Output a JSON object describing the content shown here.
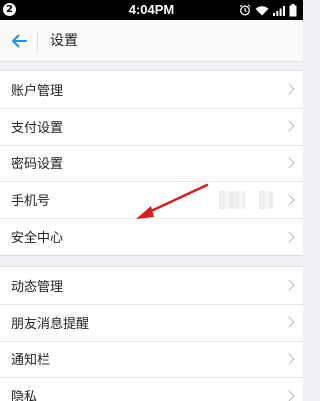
{
  "status_bar": {
    "notification_count": "2",
    "time": "4:04PM",
    "icons": [
      "alarm-icon",
      "wifi-icon",
      "signal-icon",
      "battery-icon"
    ]
  },
  "header": {
    "back_icon": "back-arrow-icon",
    "title": "设置"
  },
  "groups": [
    {
      "items": [
        {
          "label": "账户管理"
        },
        {
          "label": "支付设置"
        },
        {
          "label": "密码设置"
        },
        {
          "label": "手机号"
        },
        {
          "label": "安全中心"
        }
      ]
    },
    {
      "items": [
        {
          "label": "动态管理"
        },
        {
          "label": "朋友消息提醒"
        },
        {
          "label": "通知栏"
        },
        {
          "label": "隐私"
        }
      ]
    }
  ],
  "colors": {
    "accent": "#2a8dd8",
    "annotation_arrow": "#d21f1f",
    "page_background": "#efeff4"
  }
}
